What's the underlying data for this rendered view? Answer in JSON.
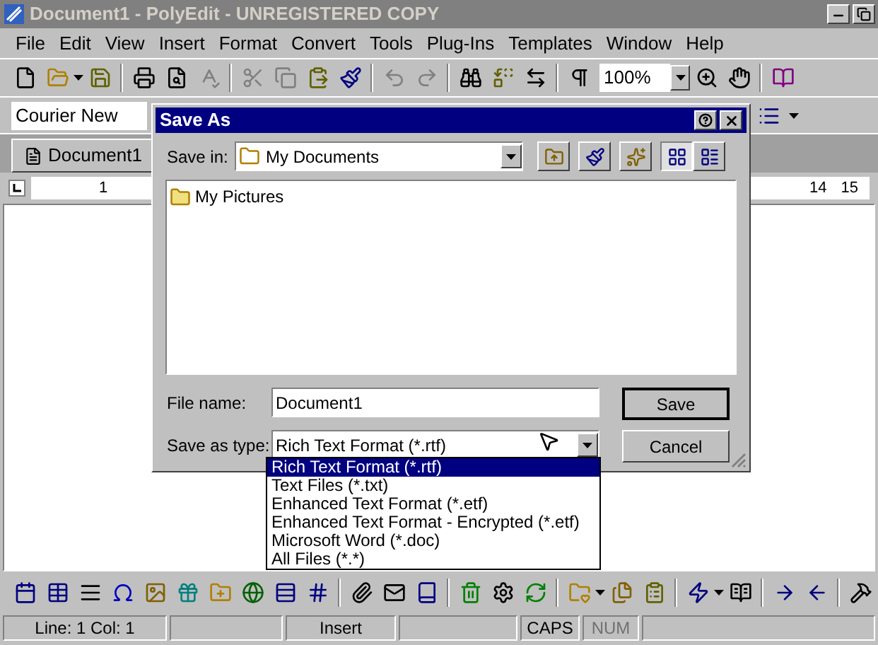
{
  "window": {
    "title": "Document1 - PolyEdit - UNREGISTERED COPY"
  },
  "menu": [
    "File",
    "Edit",
    "View",
    "Insert",
    "Format",
    "Convert",
    "Tools",
    "Plug-Ins",
    "Templates",
    "Window",
    "Help"
  ],
  "toolbar": {
    "zoom": "100%"
  },
  "format_toolbar": {
    "font": "Courier New"
  },
  "tabs": [
    {
      "label": "Document1",
      "selected": true
    }
  ],
  "ruler": [
    "1",
    "14",
    "15"
  ],
  "dialog": {
    "title": "Save As",
    "save_in_label": "Save in:",
    "save_in_value": "My Documents",
    "files": [
      {
        "name": "My Pictures"
      }
    ],
    "file_name_label": "File name:",
    "file_name_value": "Document1",
    "type_label": "Save as type:",
    "type_value": "Rich Text Format (*.rtf)",
    "buttons": [
      "Save",
      "Cancel"
    ],
    "type_options": [
      {
        "label": "Rich Text Format (*.rtf)",
        "selected": true
      },
      {
        "label": "Text Files (*.txt)",
        "selected": false
      },
      {
        "label": "Enhanced Text Format (*.etf)",
        "selected": false
      },
      {
        "label": "Enhanced Text Format - Encrypted (*.etf)",
        "selected": false
      },
      {
        "label": "Microsoft Word (*.doc)",
        "selected": false
      },
      {
        "label": "All Files (*.*)",
        "selected": false
      }
    ]
  },
  "status_bar": [
    {
      "text": "Line:  1  Col:  1",
      "disabled": false
    },
    {
      "text": "Insert",
      "disabled": false
    },
    {
      "text": "CAPS",
      "disabled": false
    },
    {
      "text": "NUM",
      "disabled": true
    }
  ]
}
